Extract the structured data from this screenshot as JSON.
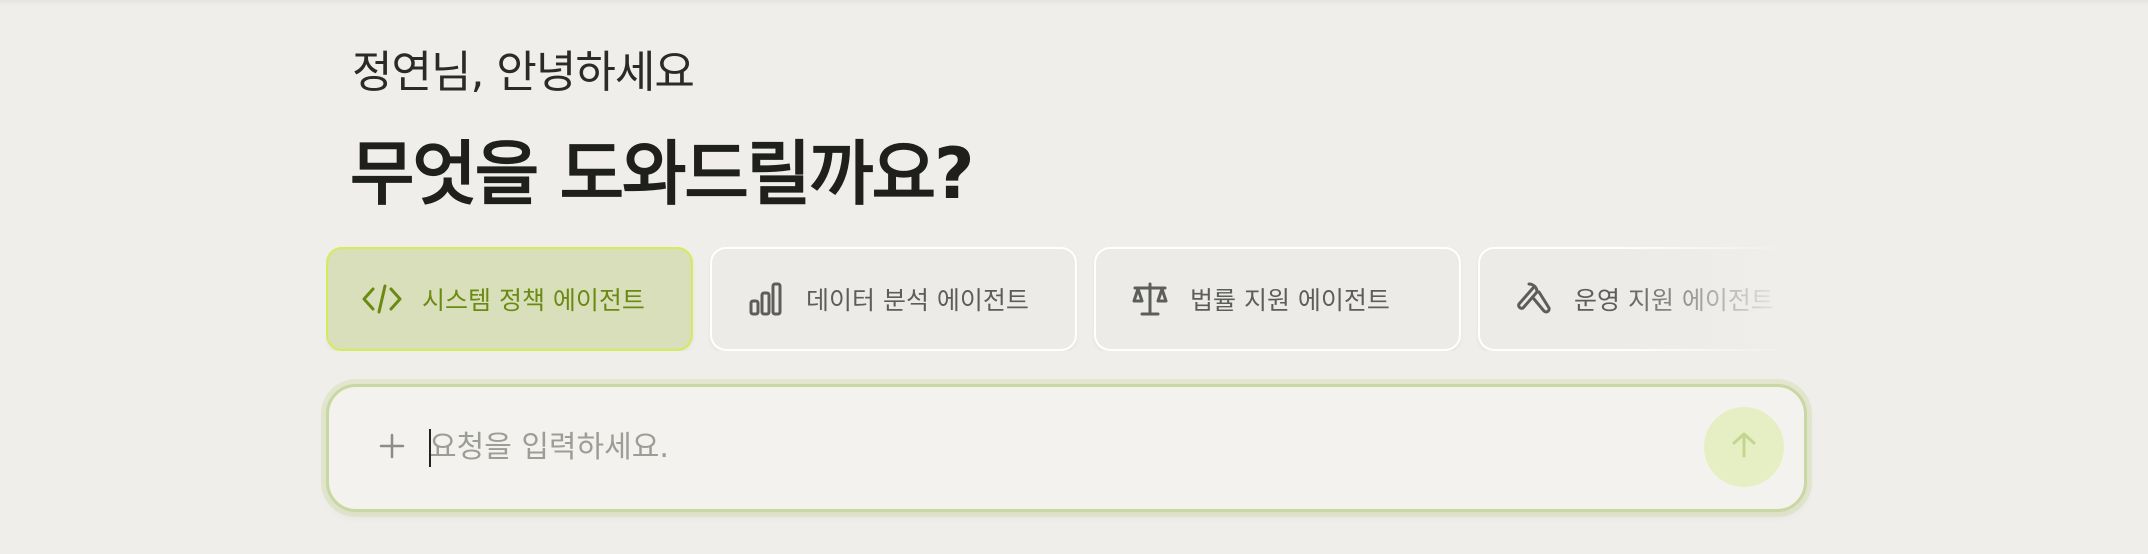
{
  "greeting": "정연님, 안녕하세요",
  "headline": "무엇을 도와드릴까요?",
  "agents": [
    {
      "label": "시스템 정책 에이전트",
      "icon": "code-icon",
      "active": true
    },
    {
      "label": "데이터 분석 에이전트",
      "icon": "bar-chart-icon",
      "active": false
    },
    {
      "label": "법률 지원 에이전트",
      "icon": "scale-icon",
      "active": false
    },
    {
      "label": "운영 지원 에이전트",
      "icon": "wrench-icon",
      "active": false
    }
  ],
  "input": {
    "placeholder": "요청을 입력하세요.",
    "value": ""
  },
  "colors": {
    "background": "#efeeea",
    "accent": "#6b8a12",
    "active_card_bg": "#d9dfba",
    "active_card_border": "#d4ec5c",
    "send_button_bg": "#e6efc4"
  }
}
